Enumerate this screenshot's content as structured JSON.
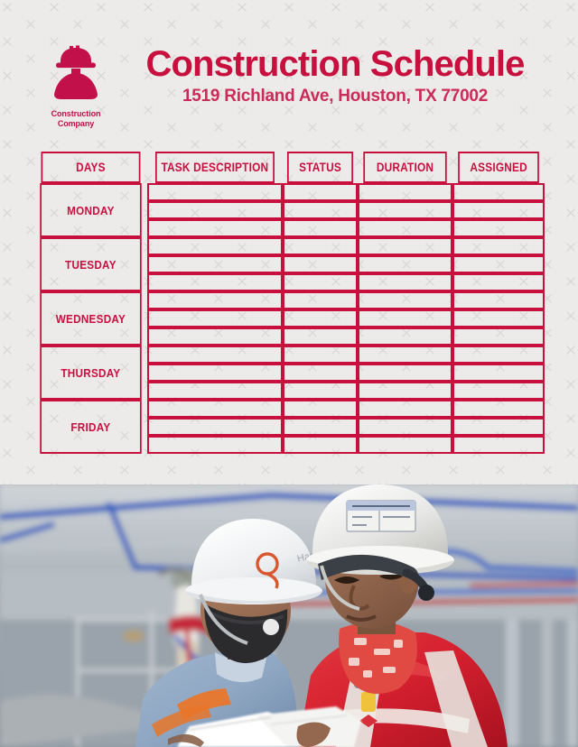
{
  "document": {
    "type": "construction-schedule-template",
    "background_color": "#ecebea",
    "accent_color": "#c8103f"
  },
  "header": {
    "logo": {
      "icon": "hard-hat-worker-icon",
      "color": "#c2114a",
      "company_line1": "Construction",
      "company_line2": "Company"
    },
    "title": "Construction Schedule",
    "address": "1519 Richland Ave, Houston, TX 77002"
  },
  "table": {
    "columns": [
      "DAYS",
      "TASK DESCRIPTION",
      "STATUS",
      "DURATION",
      "ASSIGNED"
    ],
    "rows_per_day": 3,
    "days": [
      "MONDAY",
      "TUESDAY",
      "WEDNESDAY",
      "THURSDAY",
      "FRIDAY"
    ],
    "cells": {
      "MONDAY": [
        [
          "",
          "",
          "",
          ""
        ],
        [
          "",
          "",
          "",
          ""
        ],
        [
          "",
          "",
          "",
          ""
        ]
      ],
      "TUESDAY": [
        [
          "",
          "",
          "",
          ""
        ],
        [
          "",
          "",
          "",
          ""
        ],
        [
          "",
          "",
          "",
          ""
        ]
      ],
      "WEDNESDAY": [
        [
          "",
          "",
          "",
          ""
        ],
        [
          "",
          "",
          "",
          ""
        ],
        [
          "",
          "",
          "",
          ""
        ]
      ],
      "THURSDAY": [
        [
          "",
          "",
          "",
          ""
        ],
        [
          "",
          "",
          "",
          ""
        ],
        [
          "",
          "",
          "",
          ""
        ]
      ],
      "FRIDAY": [
        [
          "",
          "",
          "",
          ""
        ],
        [
          "",
          "",
          "",
          ""
        ],
        [
          "",
          "",
          "",
          ""
        ]
      ]
    }
  },
  "photo": {
    "alt": "Two construction workers wearing hard hats reviewing blueprints on a building site",
    "subjects": [
      {
        "name": "worker-left",
        "helmet": "white",
        "uniform": "light-blue",
        "mask": "black"
      },
      {
        "name": "worker-right",
        "helmet": "white",
        "uniform": "red",
        "scarf": "red-patterned",
        "vest": "safety-harness"
      }
    ],
    "background_elements": [
      "blue-ceiling-pipes",
      "red-pipe",
      "scaffolding",
      "worker-on-scaffold"
    ]
  }
}
